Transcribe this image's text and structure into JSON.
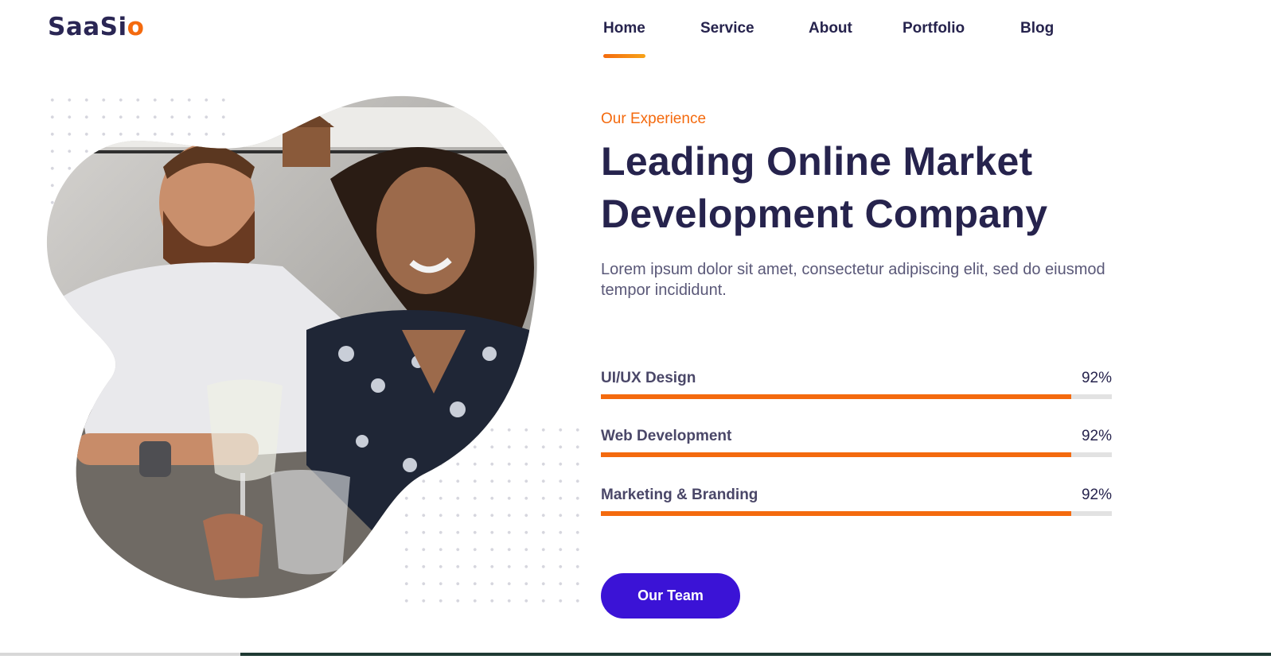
{
  "brand": {
    "name_main": "SaaSi",
    "name_accent": "o",
    "accent_color": "#f46a0e",
    "primary_color": "#26234d"
  },
  "nav": {
    "items": [
      {
        "label": "Home",
        "active": true
      },
      {
        "label": "Service"
      },
      {
        "label": "About"
      },
      {
        "label": "Portfolio"
      },
      {
        "label": "Blog"
      }
    ]
  },
  "hero": {
    "image_alt": "couple-laughing-photo",
    "kicker": "Our Experience",
    "title": "Leading Online Market Development Company",
    "description": "Lorem ipsum dolor sit amet, consectetur adipiscing elit, sed do eiusmod tempor incididunt.",
    "skills": [
      {
        "label": "UI/UX Design",
        "value": "92%",
        "fraction": 0.92
      },
      {
        "label": "Web Development",
        "value": "92%",
        "fraction": 0.92
      },
      {
        "label": "Marketing & Branding",
        "value": "92%",
        "fraction": 0.92
      }
    ],
    "cta_label": "Our Team",
    "cta_color": "#3b13d6"
  }
}
